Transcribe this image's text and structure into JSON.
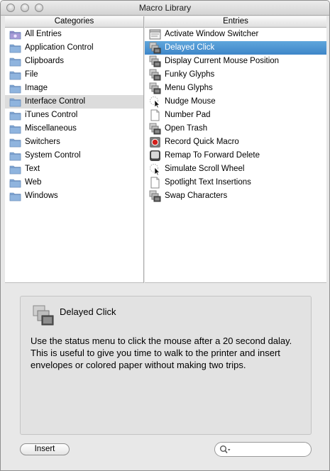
{
  "window": {
    "title": "Macro Library"
  },
  "categories": {
    "header": "Categories",
    "items": [
      {
        "label": "All Entries",
        "icon": "purple-folder-icon"
      },
      {
        "label": "Application Control",
        "icon": "folder-icon"
      },
      {
        "label": "Clipboards",
        "icon": "folder-icon"
      },
      {
        "label": "File",
        "icon": "folder-icon"
      },
      {
        "label": "Image",
        "icon": "folder-icon"
      },
      {
        "label": "Interface Control",
        "icon": "folder-icon",
        "selected": true
      },
      {
        "label": "iTunes Control",
        "icon": "folder-icon"
      },
      {
        "label": "Miscellaneous",
        "icon": "folder-icon"
      },
      {
        "label": "Switchers",
        "icon": "folder-icon"
      },
      {
        "label": "System Control",
        "icon": "folder-icon"
      },
      {
        "label": "Text",
        "icon": "folder-icon"
      },
      {
        "label": "Web",
        "icon": "folder-icon"
      },
      {
        "label": "Windows",
        "icon": "folder-icon"
      }
    ]
  },
  "entries": {
    "header": "Entries",
    "items": [
      {
        "label": "Activate Window Switcher",
        "icon": "window-icon"
      },
      {
        "label": "Delayed Click",
        "icon": "stacked-windows-icon",
        "selected": true
      },
      {
        "label": "Display Current Mouse Position",
        "icon": "stacked-windows-icon"
      },
      {
        "label": "Funky Glyphs",
        "icon": "stacked-windows-icon"
      },
      {
        "label": "Menu Glyphs",
        "icon": "stacked-windows-icon"
      },
      {
        "label": "Nudge Mouse",
        "icon": "mouse-cursor-icon"
      },
      {
        "label": "Number Pad",
        "icon": "document-icon"
      },
      {
        "label": "Open Trash",
        "icon": "stacked-windows-icon"
      },
      {
        "label": "Record Quick Macro",
        "icon": "record-icon"
      },
      {
        "label": "Remap To Forward Delete",
        "icon": "keyboard-key-icon"
      },
      {
        "label": "Simulate Scroll Wheel",
        "icon": "mouse-cursor-icon"
      },
      {
        "label": "Spotlight Text Insertions",
        "icon": "document-icon"
      },
      {
        "label": "Swap Characters",
        "icon": "stacked-windows-icon"
      }
    ]
  },
  "detail": {
    "title": "Delayed Click",
    "icon": "stacked-windows-icon",
    "description": "Use the status menu to click the mouse after a 20 second dalay. This is useful to give you time to walk to the printer and insert envelopes or colored paper without making two trips."
  },
  "footer": {
    "insert_label": "Insert",
    "search_placeholder": "",
    "search_value": ""
  },
  "colors": {
    "selection_blue": "#3e86c9",
    "selection_gray": "#dcdcdc",
    "folder_blue": "#8fb4de"
  }
}
